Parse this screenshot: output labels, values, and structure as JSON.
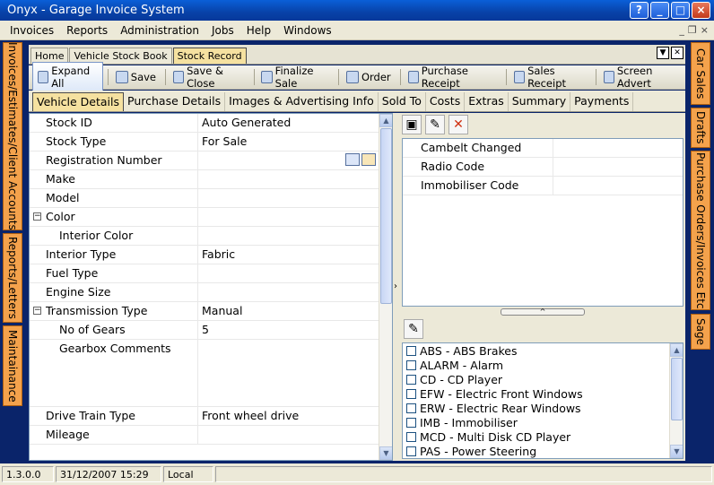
{
  "window": {
    "title": "Onyx - Garage Invoice System"
  },
  "menu": [
    "Invoices",
    "Reports",
    "Administration",
    "Jobs",
    "Help",
    "Windows"
  ],
  "left_tabs": [
    "Invoices/Estimates/Client Accounts",
    "Reports/Letters",
    "Maintainance"
  ],
  "right_tabs": [
    "Car Sales",
    "Drafts",
    "Purchase Orders/Invoices Etc",
    "Sage"
  ],
  "doc_tabs": [
    "Home",
    "Vehicle Stock Book",
    "Stock Record"
  ],
  "toolbar": [
    "Expand All",
    "Save",
    "Save & Close",
    "Finalize Sale",
    "Order",
    "Purchase Receipt",
    "Sales Receipt",
    "Screen Advert"
  ],
  "subtabs": [
    "Vehicle Details",
    "Purchase Details",
    "Images & Advertising Info",
    "Sold To",
    "Costs",
    "Extras",
    "Summary",
    "Payments"
  ],
  "props": [
    {
      "name": "Stock ID",
      "value": "Auto Generated"
    },
    {
      "name": "Stock Type",
      "value": "For Sale"
    },
    {
      "name": "Registration Number",
      "value": ""
    },
    {
      "name": "Make",
      "value": ""
    },
    {
      "name": "Model",
      "value": ""
    },
    {
      "name": "Color",
      "value": ""
    },
    {
      "name": "Interior Color",
      "value": ""
    },
    {
      "name": "Interior Type",
      "value": "Fabric"
    },
    {
      "name": "Fuel Type",
      "value": ""
    },
    {
      "name": "Engine Size",
      "value": ""
    },
    {
      "name": "Transmission Type",
      "value": "Manual"
    },
    {
      "name": "No of Gears",
      "value": "5"
    },
    {
      "name": "Gearbox Comments",
      "value": ""
    },
    {
      "name": "Drive Train Type",
      "value": "Front wheel drive"
    },
    {
      "name": "Mileage",
      "value": ""
    }
  ],
  "right_props": [
    "Cambelt Changed",
    "Radio Code",
    "Immobiliser Code"
  ],
  "extras": [
    "ABS - ABS Brakes",
    "ALARM - Alarm",
    "CD - CD Player",
    "EFW - Electric Front Windows",
    "ERW - Electric Rear Windows",
    "IMB - Immobiliser",
    "MCD - Multi Disk CD Player",
    "PAS - Power Steering"
  ],
  "status": {
    "version": "1.3.0.0",
    "datetime": "31/12/2007 15:29",
    "mode": "Local"
  },
  "colors": {
    "accent": "#0a246a",
    "side_tab": "#f4a24c",
    "active_tab": "#f5e1a0"
  }
}
